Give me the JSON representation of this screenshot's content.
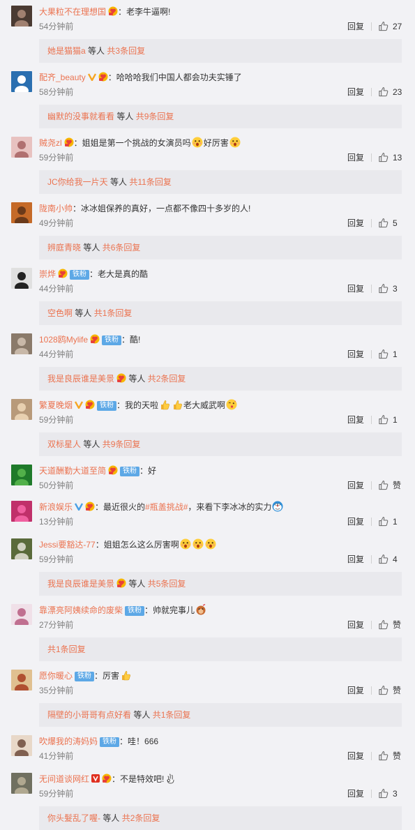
{
  "like_word": "赞",
  "reply_word": "回复",
  "colors": {
    "username": "#eb7350",
    "iron_badge": "#5da8e6",
    "orange_v": "#f6a623",
    "blue_v": "#4aa0e5",
    "red_v": "#e03020"
  },
  "comments": [
    {
      "user": "大果粒不在理想国",
      "v": null,
      "fan": true,
      "iron": null,
      "text": "：老李牛逼啊!",
      "emojis": [],
      "time": "54分钟前",
      "likes": "27",
      "sub_user": "她是猫猫a",
      "sub_mid": "等人",
      "sub_total": "共3条回复"
    },
    {
      "user": "配齐_beauty",
      "v": "orange",
      "fan": true,
      "iron": null,
      "text": "：哈哈哈我们中国人都会功夫实锤了",
      "emojis": [],
      "time": "58分钟前",
      "likes": "23",
      "sub_user": "幽默的没事就看看",
      "sub_mid": "等人",
      "sub_total": "共9条回复"
    },
    {
      "user": "贼尧zl",
      "v": null,
      "fan": true,
      "iron": null,
      "text": "：姐姐是第一个挑战的女演员吗",
      "emojis": [
        "surprise-emoji"
      ],
      "text2": "好厉害",
      "emojis2": [
        "surprise-emoji"
      ],
      "time": "59分钟前",
      "likes": "13",
      "sub_user": "JC你给我一片天",
      "sub_mid": "等人",
      "sub_total": "共11条回复"
    },
    {
      "user": "陇南小帅",
      "v": null,
      "fan": false,
      "iron": null,
      "text": "：冰冰姐保养的真好，一点都不像四十多岁的人!",
      "emojis": [],
      "time": "49分钟前",
      "likes": "5",
      "sub_user": "辨庭青晓",
      "sub_mid": "等人",
      "sub_total": "共6条回复"
    },
    {
      "user": "崇烨",
      "v": null,
      "fan": true,
      "iron": "铁粉",
      "text": "：老大是真的酷",
      "emojis": [],
      "time": "44分钟前",
      "likes": "3",
      "sub_user": "空色啊",
      "sub_mid": "等人",
      "sub_total": "共1条回复"
    },
    {
      "user": "1028鸥Mylife",
      "v": null,
      "fan": true,
      "iron": "铁粉",
      "text": "：酷!",
      "emojis": [],
      "time": "44分钟前",
      "likes": "1",
      "sub_user": "我是良辰谁是美景",
      "sub_fan": true,
      "sub_mid": "等人",
      "sub_total": "共2条回复"
    },
    {
      "user": "繁夏晚烟",
      "v": "orange",
      "fan": true,
      "iron": "铁粉",
      "text": "：我的天啦",
      "emojis": [
        "thumb-emoji",
        "thumb-emoji"
      ],
      "text2": "老大威武啊",
      "emojis2": [
        "kiss-emoji"
      ],
      "time": "59分钟前",
      "likes": "1",
      "sub_user": "双标星人",
      "sub_mid": "等人",
      "sub_total": "共9条回复"
    },
    {
      "user": "天道酬勤大道至简",
      "v": null,
      "fan": true,
      "iron": "铁粉",
      "text": "：好",
      "emojis": [],
      "time": "50分钟前",
      "likes": "赞",
      "sub_user": null
    },
    {
      "user": "新浪娱乐",
      "v": "blue",
      "fan": true,
      "iron": null,
      "text": "：最近很火的",
      "hashtag": "#瓶盖挑战#",
      "text_after": "，来看下李冰冰的实力",
      "emojis_after": [
        "doraemon-emoji"
      ],
      "time": "13分钟前",
      "likes": "1",
      "sub_user": null
    },
    {
      "user": "Jessi要豁达-77",
      "v": null,
      "fan": false,
      "iron": null,
      "text": "：姐姐怎么这么厉害啊",
      "emojis": [
        "surprise-emoji",
        "surprise-emoji",
        "surprise-emoji"
      ],
      "time": "59分钟前",
      "likes": "4",
      "sub_user": "我是良辰谁是美景",
      "sub_fan": true,
      "sub_mid": "等人",
      "sub_total": "共5条回复"
    },
    {
      "user": "靠漂亮阿姨续命的废柴",
      "v": null,
      "fan": false,
      "iron": "铁粉",
      "text": "：帅就完事儿",
      "emojis": [
        "doge-emoji"
      ],
      "time": "27分钟前",
      "likes": "赞",
      "sub_user": "",
      "sub_mid": "",
      "sub_total": "共1条回复"
    },
    {
      "user": "愿你暖心",
      "v": null,
      "fan": false,
      "iron": "铁粉",
      "text": "：厉害",
      "emojis": [
        "thumb-emoji"
      ],
      "time": "35分钟前",
      "likes": "赞",
      "sub_user": "隔壁的小哥哥有点好看",
      "sub_mid": "等人",
      "sub_total": "共1条回复"
    },
    {
      "user": "吹爆我的涛妈妈",
      "v": null,
      "fan": false,
      "iron": "铁粉",
      "text": "：哇！666",
      "emojis": [],
      "time": "41分钟前",
      "likes": "赞",
      "sub_user": null
    },
    {
      "user": "无间道谈网红",
      "v": "red",
      "fan": true,
      "iron": null,
      "text": "：不是特效吧!",
      "emojis": [
        "ok-hand-emoji"
      ],
      "time": "59分钟前",
      "likes": "3",
      "sub_user": "你头髮乱了喔-",
      "sub_mid": "等人",
      "sub_total": "共2条回复"
    }
  ]
}
